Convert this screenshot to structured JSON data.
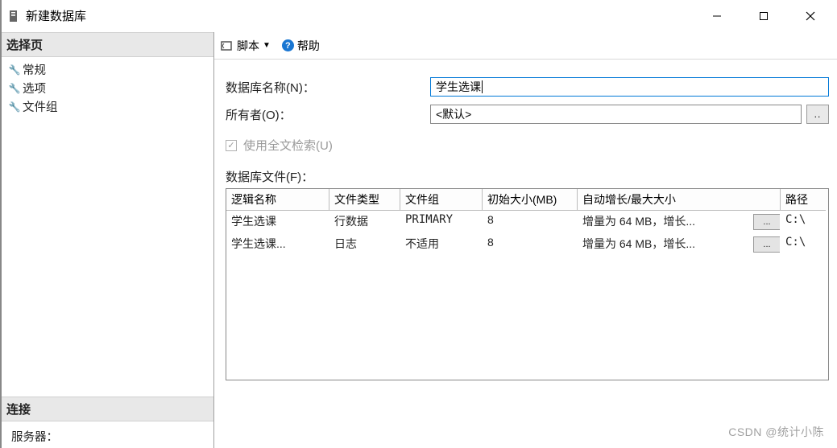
{
  "window": {
    "title": "新建数据库"
  },
  "sidebar": {
    "select_page_header": "选择页",
    "items": [
      "常规",
      "选项",
      "文件组"
    ],
    "connection_header": "连接",
    "server_label": "服务器："
  },
  "toolbar": {
    "script_label": "脚本",
    "help_label": "帮助"
  },
  "form": {
    "db_name_label": "数据库名称(N)：",
    "db_name_value": "学生选课",
    "owner_label": "所有者(O)：",
    "owner_value": "<默认>",
    "browse_label": "..",
    "fulltext_label": "使用全文检索(U)",
    "files_label": "数据库文件(F)："
  },
  "grid": {
    "headers": [
      "逻辑名称",
      "文件类型",
      "文件组",
      "初始大小(MB)",
      "自动增长/最大大小",
      "路径"
    ],
    "rows": [
      {
        "logical": "学生选课",
        "ftype": "行数据",
        "fgroup": "PRIMARY",
        "initsize": "8",
        "autogrow": "增量为 64 MB，增长...",
        "path": "C:\\"
      },
      {
        "logical": "学生选课...",
        "ftype": "日志",
        "fgroup": "不适用",
        "initsize": "8",
        "autogrow": "增量为 64 MB，增长...",
        "path": "C:\\"
      }
    ],
    "row_browse": "..."
  },
  "watermark": "CSDN @统计小陈"
}
